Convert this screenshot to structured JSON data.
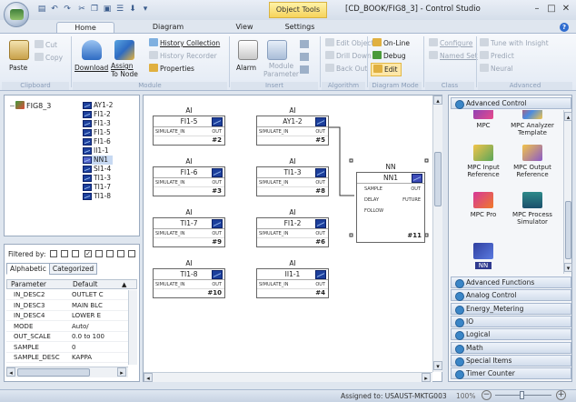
{
  "title_bar": {
    "contextual_tab": "Object Tools",
    "window_title": "[CD_BOOK/FIG8_3] - Control Studio"
  },
  "tabs": [
    "Home",
    "Diagram",
    "View",
    "Settings"
  ],
  "ribbon": {
    "clipboard": {
      "label": "Clipboard",
      "paste": "Paste",
      "cut": "Cut",
      "copy": "Copy"
    },
    "module": {
      "label": "Module",
      "download": "Download",
      "assign_line1": "Assign",
      "assign_line2": "To Node",
      "history_collection": "History Collection",
      "history_recorder": "History Recorder",
      "properties": "Properties"
    },
    "insert": {
      "label": "Insert",
      "alarm": "Alarm",
      "module_param_line1": "Module",
      "module_param_line2": "Parameter"
    },
    "algorithm": {
      "label": "Algorithm",
      "edit_object": "Edit Object",
      "drill_down": "Drill Down",
      "back_out": "Back Out"
    },
    "diagram_mode": {
      "label": "Diagram Mode",
      "online": "On-Line",
      "debug": "Debug",
      "edit": "Edit"
    },
    "class": {
      "label": "Class",
      "configure": "Configure",
      "named_set": "Named Set"
    },
    "advanced": {
      "label": "Advanced",
      "tune": "Tune with Insight",
      "predict": "Predict",
      "neural": "Neural"
    }
  },
  "tree": {
    "root": "FIG8_3",
    "items": [
      "AY1-2",
      "FI1-2",
      "FI1-3",
      "FI1-5",
      "FI1-6",
      "II1-1",
      "NN1",
      "SI1-4",
      "TI1-3",
      "TI1-7",
      "TI1-8"
    ],
    "selected": "NN1"
  },
  "properties": {
    "filter_label": "Filtered by:",
    "tabs": [
      "Alphabetic",
      "Categorized"
    ],
    "columns": [
      "Parameter",
      "Default"
    ],
    "rows": [
      [
        "IN_DESC2",
        "OUTLET C"
      ],
      [
        "IN_DESC3",
        "MAIN BLC"
      ],
      [
        "IN_DESC4",
        "LOWER E"
      ],
      [
        "MODE",
        "Auto/"
      ],
      [
        "OUT_SCALE",
        "0.0 to 100"
      ],
      [
        "SAMPLE",
        "0"
      ],
      [
        "SAMPLE_DESC",
        "KAPPA"
      ]
    ]
  },
  "canvas": {
    "blocks": [
      {
        "type": "AI",
        "name": "FI1-5",
        "input": "SIMULATE_IN",
        "output": "OUT",
        "number": "#2"
      },
      {
        "type": "AI",
        "name": "AY1-2",
        "input": "SIMULATE_IN",
        "output": "OUT",
        "number": "#5"
      },
      {
        "type": "AI",
        "name": "FI1-6",
        "input": "SIMULATE_IN",
        "output": "OUT",
        "number": "#3"
      },
      {
        "type": "AI",
        "name": "TI1-3",
        "input": "SIMULATE_IN",
        "output": "OUT",
        "number": "#8"
      },
      {
        "type": "AI",
        "name": "TI1-7",
        "input": "SIMULATE_IN",
        "output": "OUT",
        "number": "#9"
      },
      {
        "type": "AI",
        "name": "FI1-2",
        "input": "SIMULATE_IN",
        "output": "OUT",
        "number": "#6"
      },
      {
        "type": "AI",
        "name": "TI1-8",
        "input": "SIMULATE_IN",
        "output": "OUT",
        "number": "#10"
      },
      {
        "type": "AI",
        "name": "II1-1",
        "input": "SIMULATE_IN",
        "output": "OUT",
        "number": "#4"
      }
    ],
    "nn_block": {
      "type": "NN",
      "name": "NN1",
      "ports": [
        [
          "SAMPLE",
          "OUT"
        ],
        [
          "DELAY",
          "FUTURE"
        ],
        [
          "FOLLOW",
          ""
        ]
      ],
      "number": "#11"
    }
  },
  "palette": {
    "top_header": "Advanced Control",
    "items": [
      "MPC",
      "MPC Analyzer Template",
      "MPC Input Reference",
      "MPC Output Reference",
      "MPC Pro",
      "MPC Process Simulator",
      "NN"
    ],
    "categories": [
      "Advanced Functions",
      "Analog Control",
      "Energy_Metering",
      "IO",
      "Logical",
      "Math",
      "Special Items",
      "Timer Counter"
    ]
  },
  "status": {
    "assigned": "Assigned to: USAUST-MKTG003",
    "zoom": "100%"
  },
  "colors": {
    "accent_blue": "#1c3f9c",
    "object_tools": "#f6d35c",
    "ribbon_bg": "#e3eaf4"
  }
}
